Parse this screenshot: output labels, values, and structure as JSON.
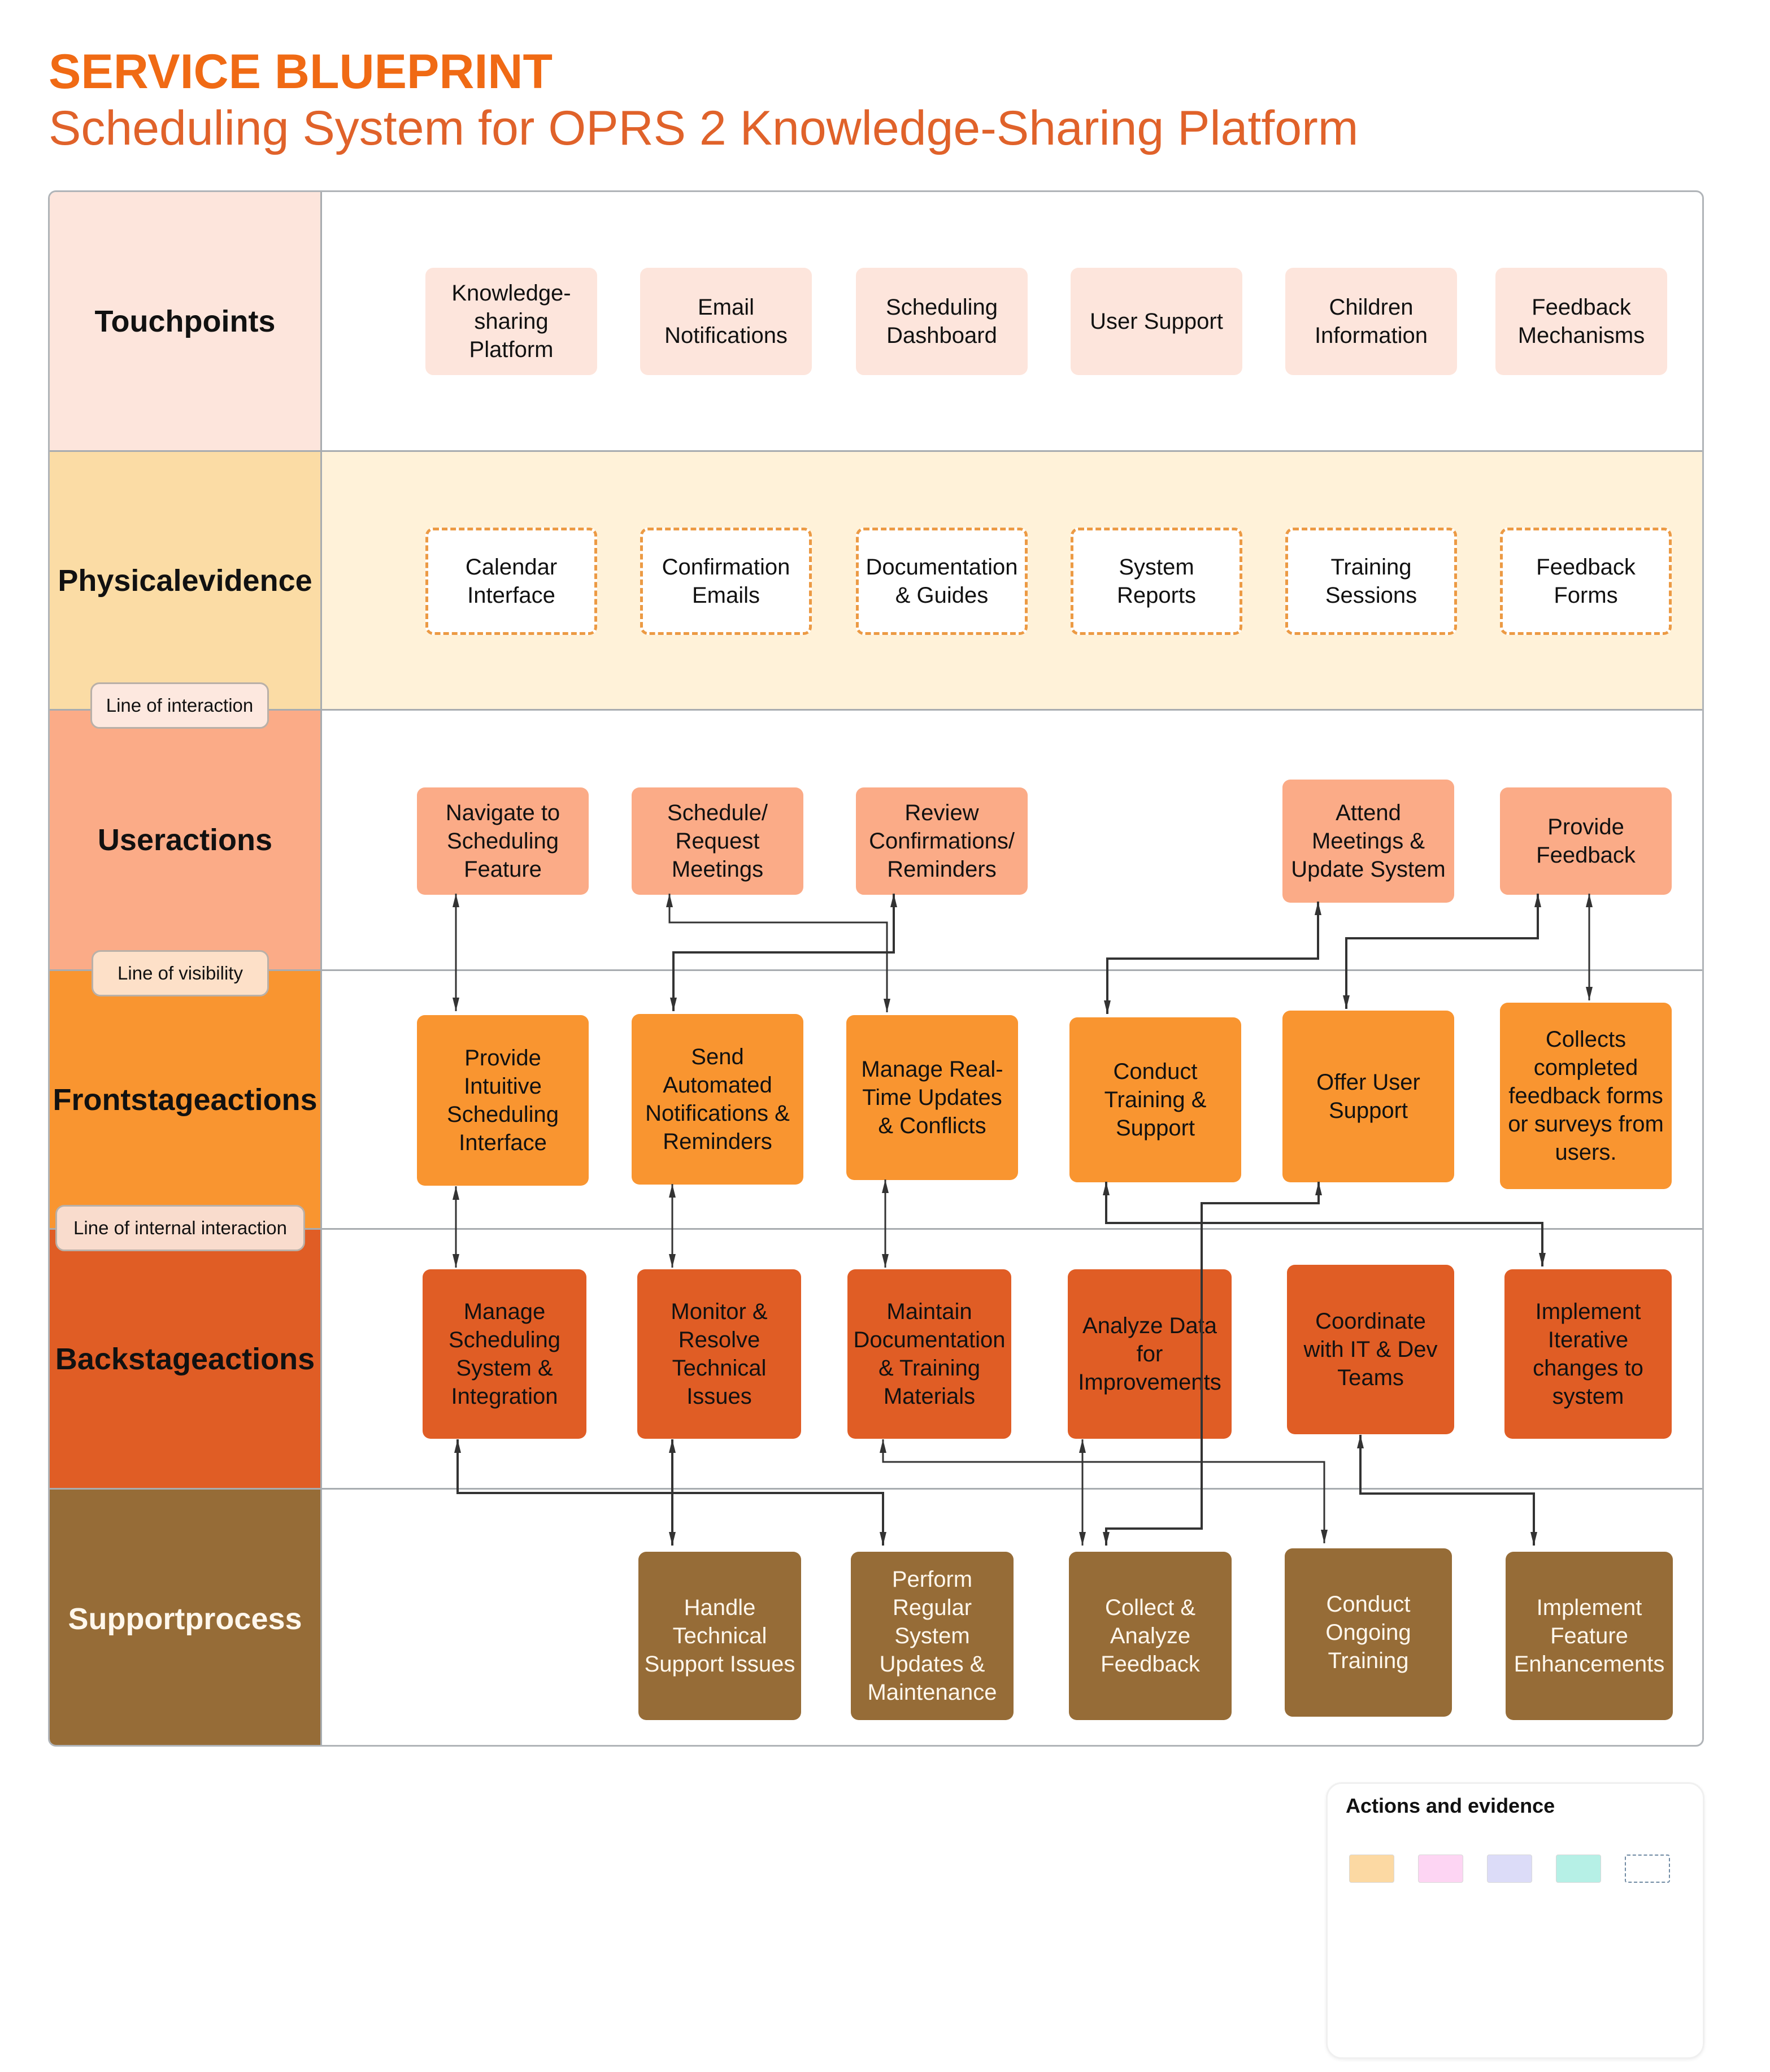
{
  "header": {
    "title": "SERVICE BLUEPRINT",
    "subtitle": "Scheduling System for OPRS 2 Knowledge-Sharing Platform"
  },
  "colors": {
    "title": "#f06a14",
    "touchpoints_lane": "#fde5dc",
    "physical_evidence_lane": "#fbdca5",
    "physical_evidence_body": "#fff2d9",
    "user_actions": "#fbab87",
    "frontstage": "#f99530",
    "backstage": "#e05d25",
    "support": "#966c37",
    "evidence_dash": "#ec9a44"
  },
  "lanes": [
    {
      "id": "touchpoints",
      "label": "Touchpoints",
      "items": [
        "Knowledge-sharing Platform",
        "Email Notifications",
        "Scheduling Dashboard",
        "User Support",
        "Children Information",
        "Feedback Mechanisms"
      ]
    },
    {
      "id": "physical-evidence",
      "label": "Physical evidence",
      "items": [
        "Calendar Interface",
        "Confirmation Emails",
        "Documentation & Guides",
        "System Reports",
        "Training Sessions",
        "Feedback Forms"
      ]
    },
    {
      "id": "user-actions",
      "label": "User actions",
      "items": [
        "Navigate to Scheduling Feature",
        "Schedule/ Request Meetings",
        "Review Confirmations/ Reminders",
        "Attend Meetings & Update System",
        "Provide Feedback"
      ]
    },
    {
      "id": "frontstage-actions",
      "label": "Frontstage actions",
      "items": [
        "Provide Intuitive Scheduling Interface",
        "Send Automated Notifications & Reminders",
        "Manage Real-Time Updates & Conflicts",
        "Conduct Training & Support",
        "Offer User Support",
        "Collects completed feedback forms or surveys from users."
      ]
    },
    {
      "id": "backstage-actions",
      "label": "Backstage actions",
      "items": [
        "Manage Scheduling System & Integration",
        "Monitor & Resolve Technical Issues",
        "Maintain Documentation & Training Materials",
        "Analyze Data for Improvements",
        "Coordinate with IT & Dev Teams",
        "Implement Iterative changes to system"
      ]
    },
    {
      "id": "support-process",
      "label": "Support process",
      "items": [
        "Handle Technical Support Issues",
        "Perform Regular System Updates & Maintenance",
        "Collect & Analyze Feedback",
        "Conduct Ongoing Training",
        "Implement Feature Enhancements"
      ]
    }
  ],
  "lines": {
    "interaction": "Line of interaction",
    "visibility": "Line of visibility",
    "internal_interaction": "Line of internal interaction"
  },
  "legend": {
    "title": "Actions and evidence",
    "swatches": [
      {
        "name": "orange",
        "color": "#fcd9a3"
      },
      {
        "name": "pink",
        "color": "#fdd5f3"
      },
      {
        "name": "lavender",
        "color": "#dcdcf8"
      },
      {
        "name": "mint",
        "color": "#b6f0e6"
      },
      {
        "name": "dashed",
        "color": "#ffffff"
      }
    ]
  }
}
